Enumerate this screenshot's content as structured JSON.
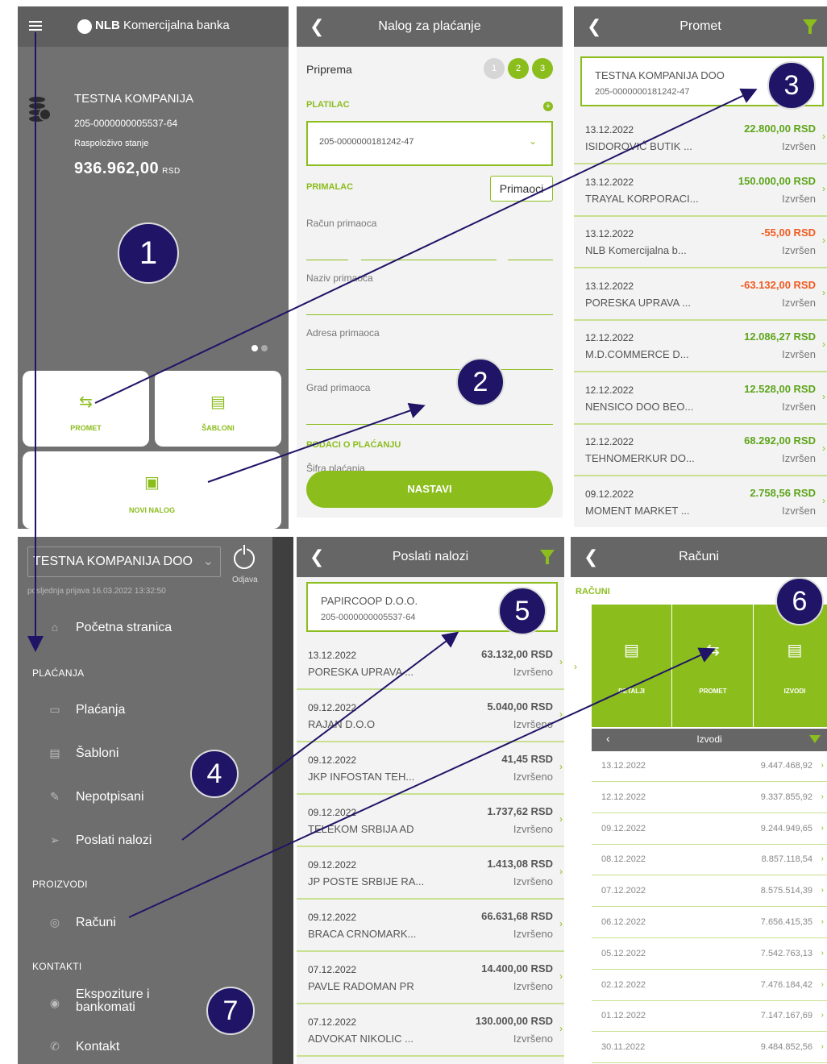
{
  "p1": {
    "brand_bold": "NLB",
    "brand_rest": "Komercijalna banka",
    "account": {
      "name": "TESTNA KOMPANIJA",
      "number": "205-0000000005537-64",
      "balance_label": "Raspoloživo stanje",
      "balance": "936.962,00",
      "currency": "RSD"
    },
    "tiles": {
      "promet": "PROMET",
      "sabloni": "ŠABLONI",
      "novi": "NOVI NALOG"
    }
  },
  "p2": {
    "title": "Nalog za plaćanje",
    "section": "Priprema",
    "steps": [
      "1",
      "2",
      "3"
    ],
    "payer_label": "PLATILAC",
    "payer_account": "205-0000000181242-47",
    "payee_label": "PRIMALAC",
    "payee_button": "Primaoci",
    "fields": [
      "Račun primaoca",
      "Naziv primaoca",
      "Adresa primaoca",
      "Grad primaoca"
    ],
    "payment_data_label": "PODACI O PLAĆANJU",
    "payment_code_label": "Šifra plaćanja",
    "continue": "NASTAVI"
  },
  "p3": {
    "title": "Promet",
    "card": {
      "name": "TESTNA KOMPANIJA DOO",
      "account": "205-0000000181242-47"
    },
    "items": [
      {
        "date": "13.12.2022",
        "name": "ISIDOROVIĆ BUTIK ...",
        "amount": "22.800,00 RSD",
        "status": "Izvršen",
        "kind": "pos"
      },
      {
        "date": "13.12.2022",
        "name": "TRAYAL KORPORACI...",
        "amount": "150.000,00 RSD",
        "status": "Izvršen",
        "kind": "pos"
      },
      {
        "date": "13.12.2022",
        "name": "NLB Komercijalna b...",
        "amount": "-55,00 RSD",
        "status": "Izvršen",
        "kind": "neg"
      },
      {
        "date": "13.12.2022",
        "name": "PORESKA UPRAVA ...",
        "amount": "-63.132,00 RSD",
        "status": "Izvršen",
        "kind": "neg"
      },
      {
        "date": "12.12.2022",
        "name": "M.D.COMMERCE D...",
        "amount": "12.086,27 RSD",
        "status": "Izvršen",
        "kind": "pos"
      },
      {
        "date": "12.12.2022",
        "name": "NENSICO DOO BEO...",
        "amount": "12.528,00 RSD",
        "status": "Izvršen",
        "kind": "pos"
      },
      {
        "date": "12.12.2022",
        "name": "TEHNOMERKUR DO...",
        "amount": "68.292,00 RSD",
        "status": "Izvršen",
        "kind": "pos"
      },
      {
        "date": "09.12.2022",
        "name": "MOMENT MARKET ...",
        "amount": "2.758,56 RSD",
        "status": "Izvršen",
        "kind": "pos"
      }
    ]
  },
  "p4": {
    "company": "TESTNA KOMPANIJA DOO",
    "logout": "Odjava",
    "last_login": "posljednja prijava  16.03.2022 13:32:50",
    "home": "Početna stranica",
    "sections": {
      "payments": "PLAĆANJA",
      "products": "PROIZVODI",
      "contacts": "KONTAKTI"
    },
    "items": {
      "placanja": "Plaćanja",
      "sabloni": "Šabloni",
      "nepotpisani": "Nepotpisani",
      "poslati": "Poslati nalozi",
      "racuni": "Računi",
      "ekspoziture": "Ekspoziture i bankomati",
      "kontakt": "Kontakt"
    }
  },
  "p5": {
    "title": "Poslati nalozi",
    "card": {
      "name": "PAPIRCOOP D.O.O.",
      "account": "205-0000000005537-64"
    },
    "items": [
      {
        "date": "13.12.2022",
        "name": "PORESKA UPRAVA ...",
        "amount": "63.132,00 RSD",
        "status": "Izvršeno"
      },
      {
        "date": "09.12.2022",
        "name": "RAJAN D.O.O",
        "amount": "5.040,00 RSD",
        "status": "Izvršeno"
      },
      {
        "date": "09.12.2022",
        "name": "JKP INFOSTAN TEH...",
        "amount": "41,45 RSD",
        "status": "Izvršeno"
      },
      {
        "date": "09.12.2022",
        "name": "TELEKOM SRBIJA AD",
        "amount": "1.737,62 RSD",
        "status": "Izvršeno"
      },
      {
        "date": "09.12.2022",
        "name": "JP POSTE SRBIJE RA...",
        "amount": "1.413,08 RSD",
        "status": "Izvršeno"
      },
      {
        "date": "09.12.2022",
        "name": "BRACA CRNOMARK...",
        "amount": "66.631,68 RSD",
        "status": "Izvršeno"
      },
      {
        "date": "07.12.2022",
        "name": "PAVLE RADOMAN PR",
        "amount": "14.400,00 RSD",
        "status": "Izvršeno"
      },
      {
        "date": "07.12.2022",
        "name": "ADVOKAT NIKOLIC ...",
        "amount": "130.000,00 RSD",
        "status": "Izvršeno"
      }
    ]
  },
  "p6": {
    "title": "Računi",
    "section": "RAČUNI",
    "tiles": {
      "detalji": "DETALJI",
      "promet": "PROMET",
      "izvodi": "IZVODI"
    },
    "statements_title": "Izvodi",
    "statements": [
      {
        "date": "13.12.2022",
        "value": "9.447.468,92"
      },
      {
        "date": "12.12.2022",
        "value": "9.337.855,92"
      },
      {
        "date": "09.12.2022",
        "value": "9.244.949,65"
      },
      {
        "date": "08.12.2022",
        "value": "8.857.118,54"
      },
      {
        "date": "07.12.2022",
        "value": "8.575.514,39"
      },
      {
        "date": "06.12.2022",
        "value": "7.656.415,35"
      },
      {
        "date": "05.12.2022",
        "value": "7.542.763,13"
      },
      {
        "date": "02.12.2022",
        "value": "7.476.184,42"
      },
      {
        "date": "01.12.2022",
        "value": "7.147.167,69"
      },
      {
        "date": "30.11.2022",
        "value": "9.484.852,56"
      }
    ]
  },
  "callouts": [
    "1",
    "2",
    "3",
    "4",
    "5",
    "6",
    "7"
  ],
  "colors": {
    "accent": "#8bbd1d",
    "badge": "#1f1466",
    "positive": "#5da51a",
    "negative": "#f15a22",
    "panel_dark": "#6e6e6e"
  },
  "icons": {
    "menu": "hamburger-icon",
    "back": "chevron-left-icon",
    "filter": "filter-icon",
    "promet": "transfer-arrows-icon",
    "sabloni": "document-icon",
    "novi_nalog": "banknote-icon",
    "logout": "power-icon",
    "home": "home-icon",
    "racuni": "coins-icon",
    "location": "location-pin-icon",
    "phone": "phone-icon"
  }
}
